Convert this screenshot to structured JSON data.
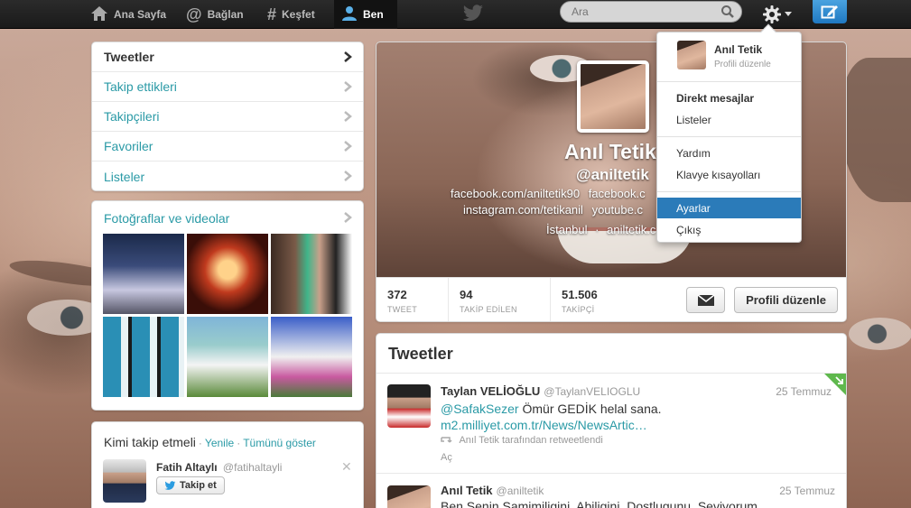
{
  "topnav": {
    "home": "Ana Sayfa",
    "connect": "Bağlan",
    "discover": "Keşfet",
    "me": "Ben"
  },
  "search": {
    "placeholder": "Ara"
  },
  "left_nav": {
    "items": [
      {
        "label": "Tweetler"
      },
      {
        "label": "Takip ettikleri"
      },
      {
        "label": "Takipçileri"
      },
      {
        "label": "Favoriler"
      },
      {
        "label": "Listeler"
      }
    ]
  },
  "photos": {
    "title": "Fotoğraflar ve videolar"
  },
  "who_to_follow": {
    "title": "Kimi takip etmeli",
    "refresh": "Yenile",
    "view_all": "Tümünü göster",
    "separator": "·",
    "suggestion": {
      "name": "Fatih Altaylı",
      "handle": "@fatihaltayli",
      "follow_label": "Takip et"
    }
  },
  "profile": {
    "name": "Anıl Tetik",
    "handle": "@aniltetik",
    "links_line1_a": "facebook.com/aniltetik90",
    "links_line1_b": "facebook.c",
    "links_line2_a": "instagram.com/tetikanil",
    "links_line2_b": "youtube.c",
    "location": "İstanbul",
    "location_sep": "·",
    "website": "aniltetik.c",
    "stats": [
      {
        "num": "372",
        "label": "TWEET"
      },
      {
        "num": "94",
        "label": "TAKİP EDİLEN"
      },
      {
        "num": "51.506",
        "label": "TAKİPÇİ"
      }
    ],
    "edit_label": "Profili düzenle"
  },
  "dropdown": {
    "user_name": "Anıl Tetik",
    "user_sub": "Profili düzenle",
    "items": [
      {
        "label": "Direkt mesajlar"
      },
      {
        "label": "Listeler"
      },
      {
        "label": "Yardım"
      },
      {
        "label": "Klavye kısayolları"
      },
      {
        "label": "Ayarlar"
      },
      {
        "label": "Çıkış"
      }
    ]
  },
  "tweets": {
    "title": "Tweetler",
    "items": [
      {
        "name": "Taylan VELİOĞLU",
        "handle": "@TaylanVELIOGLU",
        "time": "25 Temmuz",
        "mention": "@SafakSezer",
        "text": " Ömür GEDİK helal sana. ",
        "link": "m2.milliyet.com.tr/News/NewsArtic…",
        "retweet": "Anıl Tetik tarafından retweetlendi",
        "expand": "Aç"
      },
      {
        "name": "Anıl Tetik",
        "handle": "@aniltetik",
        "time": "25 Temmuz",
        "text": "Ben Senin Samimiligini, Abiligini, Dostlugunu, Seviyorum"
      }
    ]
  },
  "colors": {
    "link": "#2a9aa6",
    "accent": "#2b7bb9",
    "topbar": "#1a1a1a"
  }
}
